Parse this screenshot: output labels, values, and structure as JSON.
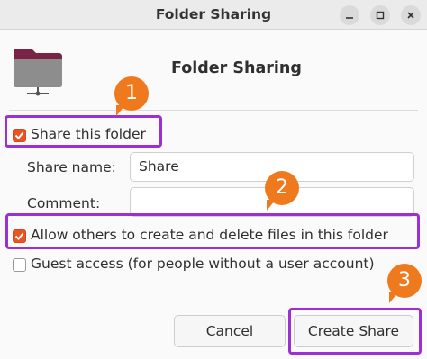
{
  "window": {
    "title": "Folder Sharing"
  },
  "header": {
    "title": "Folder Sharing",
    "icon": "folder-share-icon"
  },
  "share_folder": {
    "label": "Share this folder",
    "checked": true
  },
  "share_name": {
    "label": "Share name:",
    "value": "Share"
  },
  "comment": {
    "label": "Comment:",
    "value": ""
  },
  "allow_others": {
    "label": "Allow others to create and delete files in this folder",
    "checked": true
  },
  "guest_access": {
    "label": "Guest access (for people without a user account)",
    "checked": false
  },
  "buttons": {
    "cancel": "Cancel",
    "create": "Create Share"
  },
  "annotations": {
    "step1": "1",
    "step2": "2",
    "step3": "3"
  },
  "colors": {
    "accent": "#e95420",
    "highlight": "#9c2fd6",
    "badge": "#ef7a1d"
  }
}
